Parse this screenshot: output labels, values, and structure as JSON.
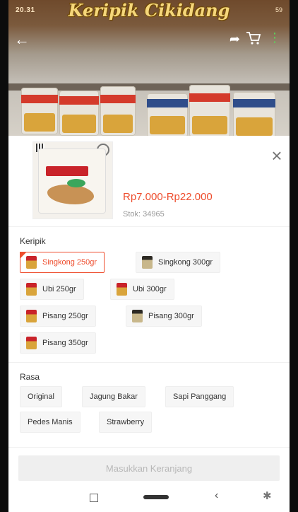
{
  "status_bar": {
    "time": "20.31",
    "right_text": "59"
  },
  "header": {
    "title": "Keripik Cikidang"
  },
  "icons": {
    "back": "arrow-left-icon",
    "share": "share-icon",
    "cart": "cart-icon",
    "more": "more-vertical-icon",
    "close": "close-icon"
  },
  "product": {
    "price": "Rp7.000-Rp22.000",
    "stock": "Stok: 34965"
  },
  "variants": {
    "label": "Keripik",
    "options": [
      {
        "label": "Singkong 250gr",
        "selected": true
      },
      {
        "label": "Singkong 300gr",
        "selected": false
      },
      {
        "label": "Ubi 250gr",
        "selected": false
      },
      {
        "label": "Ubi 300gr",
        "selected": false
      },
      {
        "label": "Pisang 250gr",
        "selected": false
      },
      {
        "label": "Pisang 300gr",
        "selected": false
      },
      {
        "label": "Pisang 350gr",
        "selected": false
      }
    ]
  },
  "flavors": {
    "label": "Rasa",
    "options": [
      "Original",
      "Jagung Bakar",
      "Sapi Panggang",
      "Pedes Manis",
      "Strawberry"
    ]
  },
  "cta": {
    "label": "Masukkan Keranjang"
  },
  "colors": {
    "accent": "#ee4d2d"
  }
}
